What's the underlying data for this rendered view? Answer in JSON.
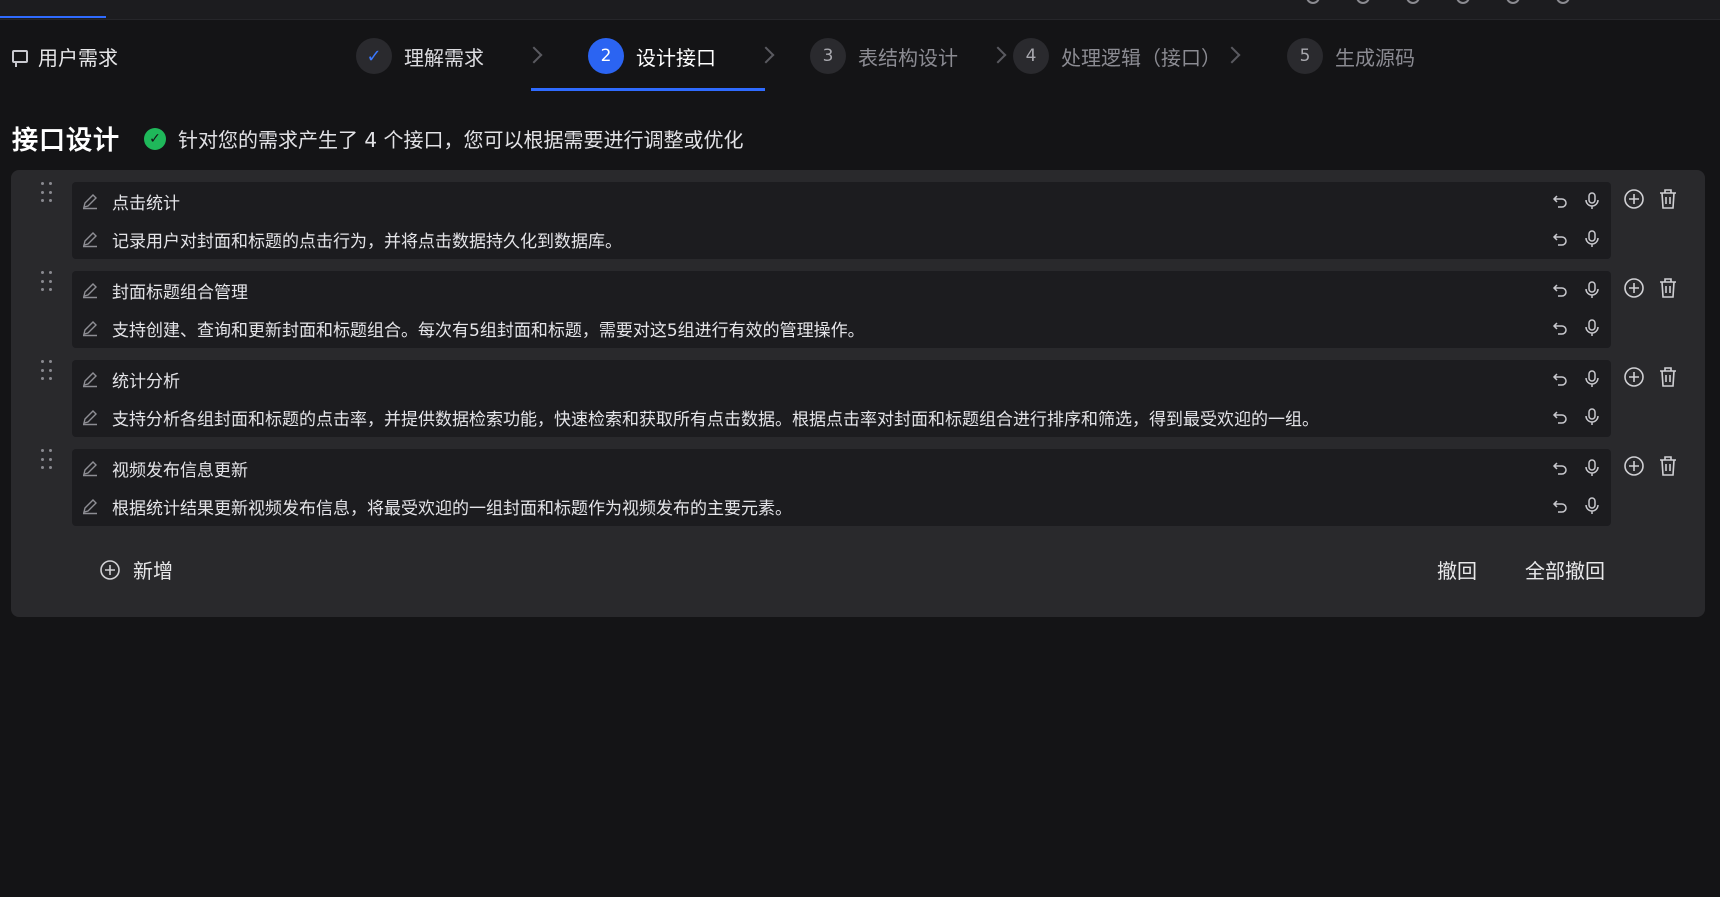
{
  "stepper": {
    "requirement_label": "用户需求",
    "steps": [
      {
        "number": "✓",
        "label": "理解需求",
        "state": "done"
      },
      {
        "number": "2",
        "label": "设计接口",
        "state": "active"
      },
      {
        "number": "3",
        "label": "表结构设计",
        "state": "pending"
      },
      {
        "number": "4",
        "label": "处理逻辑（接口）",
        "state": "pending"
      },
      {
        "number": "5",
        "label": "生成源码",
        "state": "pending"
      }
    ]
  },
  "heading": {
    "title": "接口设计",
    "note": "针对您的需求产生了 4 个接口，您可以根据需要进行调整或优化"
  },
  "apis": [
    {
      "name": "点击统计",
      "description": "记录用户对封面和标题的点击行为，并将点击数据持久化到数据库。"
    },
    {
      "name": "封面标题组合管理",
      "description": "支持创建、查询和更新封面和标题组合。每次有5组封面和标题，需要对这5组进行有效的管理操作。"
    },
    {
      "name": "统计分析",
      "description": "支持分析各组封面和标题的点击率，并提供数据检索功能，快速检索和获取所有点击数据。根据点击率对封面和标题组合进行排序和筛选，得到最受欢迎的一组。"
    },
    {
      "name": "视频发布信息更新",
      "description": "根据统计结果更新视频发布信息，将最受欢迎的一组封面和标题作为视频发布的主要元素。"
    }
  ],
  "actions": {
    "add_label": "新增",
    "undo_label": "撤回",
    "undo_all_label": "全部撤回"
  },
  "icons": {
    "edit": "pencil-icon",
    "undo": "undo-icon",
    "voice": "microphone-icon",
    "add": "plus-circle-icon",
    "delete": "trash-icon",
    "drag": "drag-handle-icon"
  },
  "colors": {
    "accent": "#2f6bff",
    "success": "#1fb85a",
    "background": "#141416",
    "panel": "#29292c",
    "card": "#1c1c1f"
  }
}
